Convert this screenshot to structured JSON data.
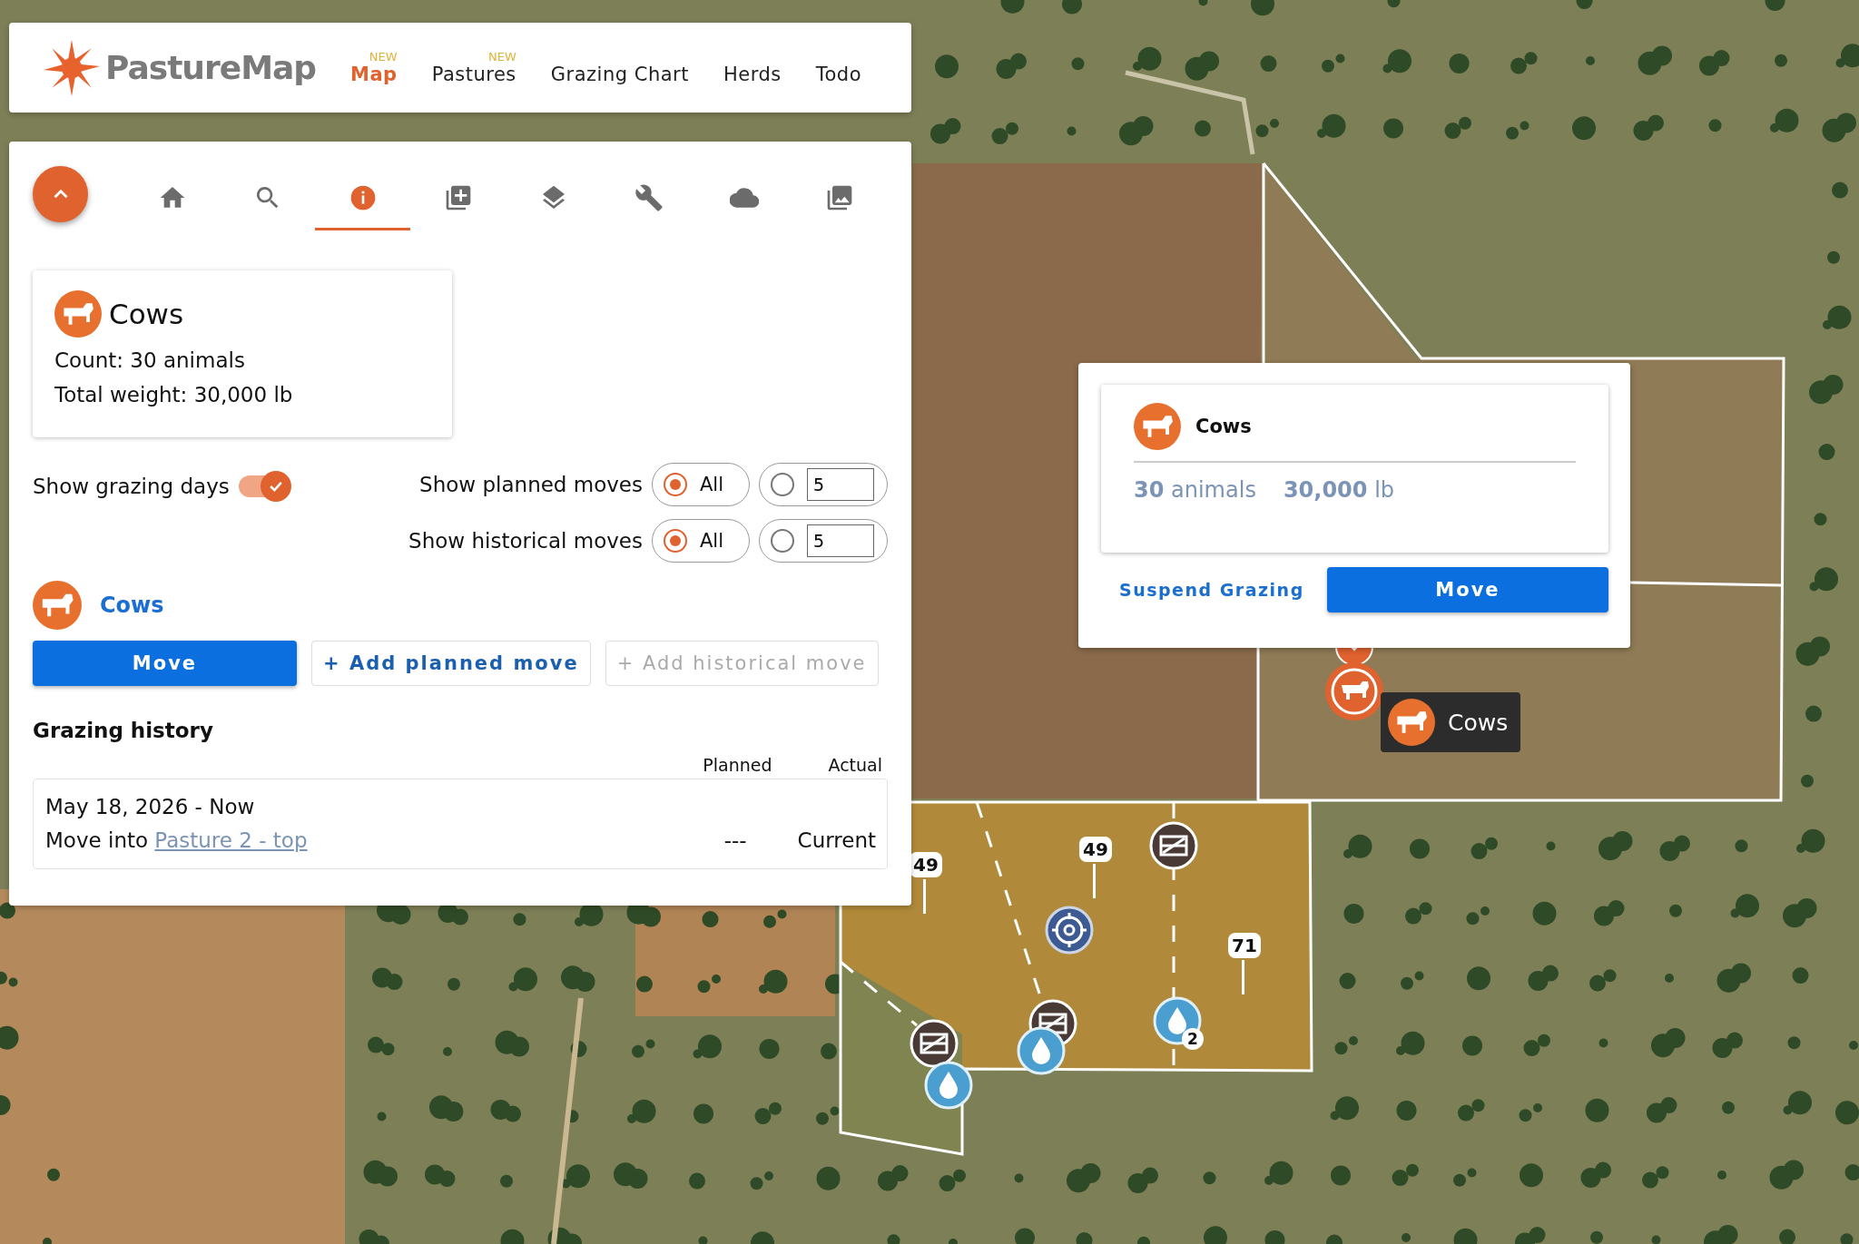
{
  "nav": {
    "logo": "PastureMap",
    "items": [
      {
        "label": "Map",
        "badge": "NEW",
        "selected": true
      },
      {
        "label": "Pastures",
        "badge": "NEW",
        "selected": false
      },
      {
        "label": "Grazing Chart",
        "selected": false
      },
      {
        "label": "Herds",
        "selected": false
      },
      {
        "label": "Todo",
        "selected": false
      }
    ]
  },
  "toolbar": {
    "tabs": [
      {
        "kind": "home",
        "selected": false
      },
      {
        "kind": "search",
        "selected": false
      },
      {
        "kind": "info",
        "selected": true
      },
      {
        "kind": "add",
        "selected": false
      },
      {
        "kind": "layers",
        "selected": false
      },
      {
        "kind": "wrench",
        "selected": false
      },
      {
        "kind": "cloud",
        "selected": false
      },
      {
        "kind": "photos",
        "selected": false
      }
    ]
  },
  "herd_card": {
    "name": "Cows",
    "count": "Count: 30 animals",
    "weight": "Total weight: 30,000 lb"
  },
  "options": {
    "grazing_days": {
      "label": "Show grazing days",
      "on": true
    },
    "move_filters": [
      {
        "label": "Show planned moves",
        "all": "All",
        "number": "5",
        "all_selected": true
      },
      {
        "label": "Show historical moves",
        "all": "All",
        "number": "5",
        "all_selected": true
      }
    ]
  },
  "herd": {
    "name": "Cows",
    "buttons": [
      {
        "label": "Move",
        "kind": "primary",
        "disabled": false
      },
      {
        "label": "+ Add planned move",
        "kind": "outline",
        "disabled": false
      },
      {
        "label": "+ Add historical move",
        "kind": "outline",
        "disabled": true
      }
    ]
  },
  "history": {
    "title": "Grazing history",
    "columns": [
      "Planned",
      "Actual"
    ],
    "rows": [
      {
        "dates": "May 18, 2026 - Now",
        "action": "Move into",
        "pasture": "Pasture 2 - top",
        "planned": "---",
        "actual": "Current"
      }
    ]
  },
  "popup": {
    "name": "Cows",
    "count": "30",
    "count_unit": "animals",
    "weight": "30,000",
    "weight_unit": "lb",
    "link": "Suspend Grazing",
    "button": "Move"
  },
  "map": {
    "herd_label": "Cows",
    "grazing_days": [
      "49",
      "49",
      "71"
    ],
    "water_badge": "2"
  }
}
